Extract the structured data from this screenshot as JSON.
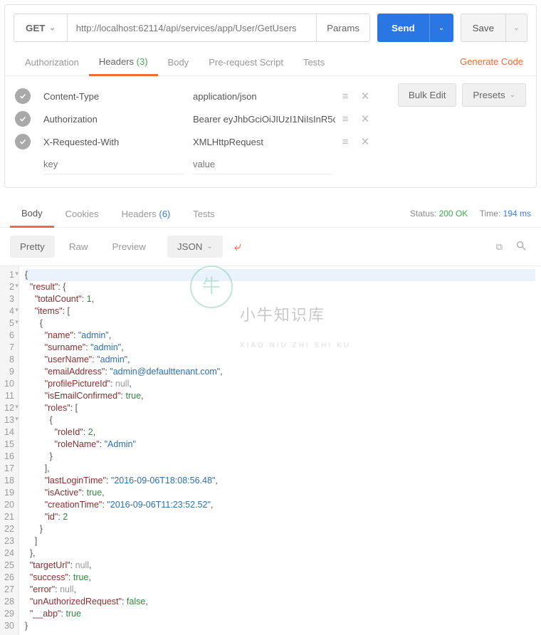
{
  "request": {
    "method": "GET",
    "url": "http://localhost:62114/api/services/app/User/GetUsers",
    "params_label": "Params",
    "send_label": "Send",
    "save_label": "Save"
  },
  "req_tabs": {
    "authorization": "Authorization",
    "headers": "Headers",
    "headers_count": "(3)",
    "body": "Body",
    "prerequest": "Pre-request Script",
    "tests": "Tests",
    "generate_code": "Generate Code"
  },
  "header_actions": {
    "bulk_edit": "Bulk Edit",
    "presets": "Presets"
  },
  "headers": [
    {
      "key": "Content-Type",
      "value": "application/json"
    },
    {
      "key": "Authorization",
      "value": "Bearer eyJhbGciOiJIUzI1NiIsInR5c"
    },
    {
      "key": "X-Requested-With",
      "value": "XMLHttpRequest"
    }
  ],
  "header_placeholders": {
    "key": "key",
    "value": "value"
  },
  "resp_tabs": {
    "body": "Body",
    "cookies": "Cookies",
    "headers": "Headers",
    "headers_count": "(6)",
    "tests": "Tests"
  },
  "resp_meta": {
    "status_label": "Status:",
    "status_value": "200 OK",
    "time_label": "Time:",
    "time_value": "194 ms"
  },
  "resp_toolbar": {
    "pretty": "Pretty",
    "raw": "Raw",
    "preview": "Preview",
    "format": "JSON"
  },
  "response_body": {
    "result": {
      "totalCount": 1,
      "items": [
        {
          "name": "admin",
          "surname": "admin",
          "userName": "admin",
          "emailAddress": "admin@defaulttenant.com",
          "profilePictureId": null,
          "isEmailConfirmed": true,
          "roles": [
            {
              "roleId": 2,
              "roleName": "Admin"
            }
          ],
          "lastLoginTime": "2016-09-06T18:08:56.48",
          "isActive": true,
          "creationTime": "2016-09-06T11:23:52.52",
          "id": 2
        }
      ]
    },
    "targetUrl": null,
    "success": true,
    "error": null,
    "unAuthorizedRequest": false,
    "__abp": true
  },
  "fold_lines": [
    1,
    2,
    4,
    5,
    12,
    13
  ],
  "watermark": {
    "title": "小牛知识库",
    "sub": "XIAO NIU ZHI SHI KU"
  }
}
